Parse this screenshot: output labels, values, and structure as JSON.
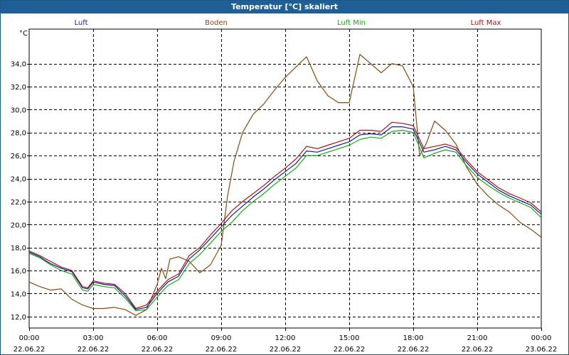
{
  "window": {
    "title": "Temperatur [°C] skaliert"
  },
  "legend": [
    {
      "label": "Luft",
      "color": "#1a1aa0"
    },
    {
      "label": "Boden",
      "color": "#8a4a10"
    },
    {
      "label": "Luft Min",
      "color": "#10b010"
    },
    {
      "label": "Luft Max",
      "color": "#b01010"
    }
  ],
  "chart_data": {
    "type": "line",
    "ylabel": "°C",
    "ylim": [
      11.0,
      37.0
    ],
    "xlim": [
      "2022-06-22 00:00",
      "2022-06-23 00:00"
    ],
    "y_ticks": [
      "12,0",
      "14,0",
      "16,0",
      "18,0",
      "20,0",
      "22,0",
      "24,0",
      "26,0",
      "28,0",
      "30,0",
      "32,0",
      "34,0"
    ],
    "y_tick_values": [
      12,
      14,
      16,
      18,
      20,
      22,
      24,
      26,
      28,
      30,
      32,
      34
    ],
    "x_ticks": [
      {
        "hours": 0,
        "time": "00:00",
        "date": "22.06.22"
      },
      {
        "hours": 3,
        "time": "03:00",
        "date": "22.06.22"
      },
      {
        "hours": 6,
        "time": "06:00",
        "date": "22.06.22"
      },
      {
        "hours": 9,
        "time": "09:00",
        "date": "22.06.22"
      },
      {
        "hours": 12,
        "time": "12:00",
        "date": "22.06.22"
      },
      {
        "hours": 15,
        "time": "15:00",
        "date": "22.06.22"
      },
      {
        "hours": 18,
        "time": "18:00",
        "date": "22.06.22"
      },
      {
        "hours": 21,
        "time": "21:00",
        "date": "22.06.22"
      },
      {
        "hours": 24,
        "time": "00:00",
        "date": "23.06.22"
      }
    ],
    "grid": true,
    "legend_position": "top",
    "series": [
      {
        "name": "Luft",
        "color": "#1a1aa0",
        "x": [
          0,
          0.5,
          1,
          1.5,
          2,
          2.5,
          2.75,
          3,
          3.5,
          4,
          4.5,
          5,
          5.5,
          6,
          6.5,
          7,
          7.5,
          8,
          8.5,
          9,
          9.5,
          10,
          10.5,
          11,
          11.5,
          12,
          12.5,
          13,
          13.5,
          14,
          14.5,
          15,
          15.5,
          16,
          16.5,
          17,
          17.5,
          18,
          18.5,
          19,
          19.5,
          20,
          20.5,
          21,
          21.5,
          22,
          22.5,
          23,
          23.5,
          24
        ],
        "y": [
          17.6,
          17.2,
          16.6,
          16.2,
          15.9,
          14.5,
          14.4,
          15.0,
          14.8,
          14.7,
          13.8,
          12.6,
          12.8,
          14.0,
          15.0,
          15.5,
          17.0,
          17.8,
          18.8,
          19.8,
          20.8,
          21.6,
          22.4,
          23.1,
          23.9,
          24.6,
          25.3,
          26.4,
          26.3,
          26.6,
          26.9,
          27.2,
          27.8,
          27.9,
          27.8,
          28.5,
          28.5,
          28.3,
          26.3,
          26.5,
          26.8,
          26.5,
          25.4,
          24.4,
          23.7,
          23.0,
          22.5,
          22.1,
          21.7,
          20.9
        ]
      },
      {
        "name": "Boden",
        "color": "#8a4a10",
        "x": [
          0,
          0.5,
          1,
          1.5,
          2,
          2.5,
          3,
          3.5,
          4,
          4.5,
          5,
          5.5,
          6,
          6.2,
          6.4,
          6.6,
          7,
          7.5,
          8,
          8.5,
          9,
          9.3,
          9.6,
          10,
          10.5,
          11,
          11.5,
          12,
          12.5,
          13,
          13.5,
          14,
          14.5,
          15,
          15.5,
          16,
          16.5,
          17,
          17.5,
          18,
          18.3,
          18.6,
          19,
          19.5,
          20,
          20.5,
          21,
          21.5,
          22,
          22.5,
          23,
          23.5,
          24
        ],
        "y": [
          15.0,
          14.6,
          14.3,
          14.4,
          13.5,
          13.0,
          12.7,
          12.7,
          12.8,
          12.6,
          12.1,
          12.6,
          14.8,
          16.2,
          15.3,
          17.0,
          17.2,
          16.8,
          15.8,
          16.5,
          18.2,
          22.5,
          25.5,
          28.0,
          29.6,
          30.5,
          31.7,
          32.8,
          33.7,
          34.6,
          32.5,
          31.2,
          30.6,
          30.6,
          34.8,
          34.0,
          33.2,
          34.0,
          33.8,
          32.0,
          26.0,
          27.0,
          29.0,
          28.2,
          27.0,
          25.0,
          23.5,
          22.5,
          21.7,
          21.1,
          20.2,
          19.6,
          18.9
        ]
      },
      {
        "name": "Luft Min",
        "color": "#10b010",
        "x": [
          0,
          0.5,
          1,
          1.5,
          2,
          2.5,
          2.75,
          3,
          3.5,
          4,
          4.5,
          5,
          5.5,
          6,
          6.5,
          7,
          7.5,
          8,
          8.5,
          9,
          9.5,
          10,
          10.5,
          11,
          11.5,
          12,
          12.5,
          13,
          13.5,
          14,
          14.5,
          15,
          15.5,
          16,
          16.5,
          17,
          17.5,
          18,
          18.5,
          19,
          19.5,
          20,
          20.5,
          21,
          21.5,
          22,
          22.5,
          23,
          23.5,
          24
        ],
        "y": [
          17.5,
          17.1,
          16.5,
          16.0,
          15.7,
          14.3,
          14.2,
          14.8,
          14.6,
          14.5,
          13.6,
          12.5,
          12.6,
          13.7,
          14.7,
          15.2,
          16.6,
          17.4,
          18.4,
          19.4,
          20.2,
          21.2,
          22.0,
          22.7,
          23.5,
          24.2,
          24.9,
          26.0,
          26.0,
          26.3,
          26.6,
          26.9,
          27.4,
          27.6,
          27.5,
          28.1,
          28.2,
          28.0,
          25.8,
          26.2,
          26.5,
          26.3,
          25.1,
          24.1,
          23.4,
          22.8,
          22.3,
          21.9,
          21.5,
          20.6
        ]
      },
      {
        "name": "Luft Max",
        "color": "#b01010",
        "x": [
          0,
          0.5,
          1,
          1.5,
          2,
          2.5,
          2.75,
          3,
          3.5,
          4,
          4.5,
          5,
          5.5,
          6,
          6.5,
          7,
          7.5,
          8,
          8.5,
          9,
          9.5,
          10,
          10.5,
          11,
          11.5,
          12,
          12.5,
          13,
          13.5,
          14,
          14.5,
          15,
          15.5,
          16,
          16.5,
          17,
          17.5,
          18,
          18.5,
          19,
          19.5,
          20,
          20.5,
          21,
          21.5,
          22,
          22.5,
          23,
          23.5,
          24
        ],
        "y": [
          17.7,
          17.3,
          16.8,
          16.3,
          16.0,
          14.6,
          14.5,
          15.1,
          14.9,
          14.8,
          14.0,
          12.7,
          13.0,
          14.2,
          15.2,
          15.7,
          17.3,
          18.0,
          19.1,
          20.1,
          21.2,
          22.0,
          22.7,
          23.4,
          24.2,
          24.9,
          25.7,
          26.8,
          26.6,
          26.9,
          27.2,
          27.5,
          28.2,
          28.2,
          28.1,
          28.9,
          28.8,
          28.6,
          26.6,
          26.8,
          27.0,
          26.7,
          25.6,
          24.6,
          23.9,
          23.2,
          22.7,
          22.3,
          21.9,
          21.1
        ]
      }
    ]
  }
}
